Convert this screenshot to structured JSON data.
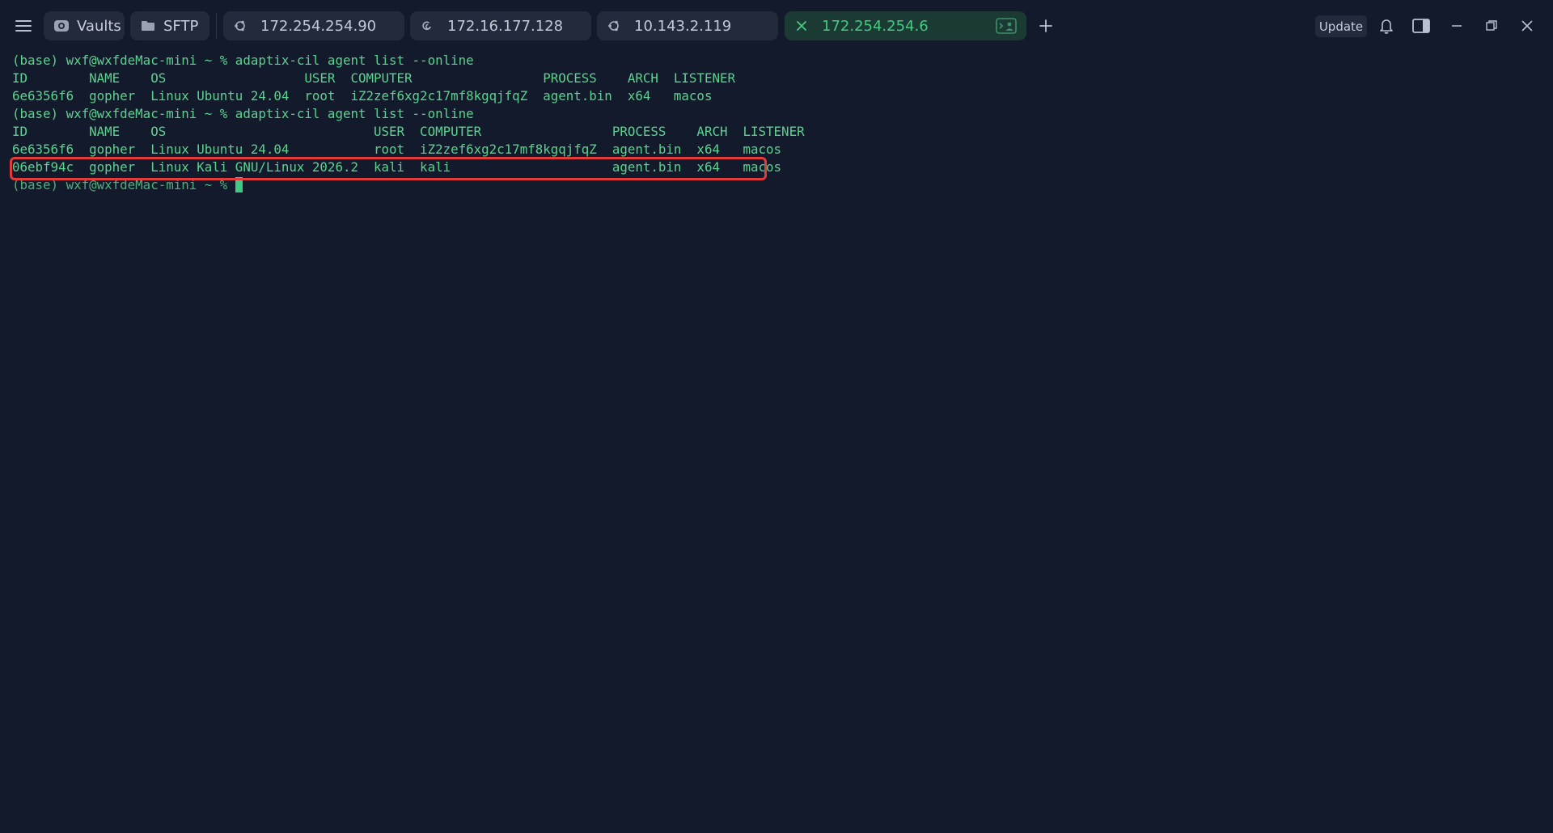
{
  "toolbar": {
    "vaults_label": "Vaults",
    "sftp_label": "SFTP",
    "update_label": "Update"
  },
  "tabs": [
    {
      "label": "172.254.254.90",
      "icon": "ubuntu-icon",
      "active": false
    },
    {
      "label": "172.16.177.128",
      "icon": "debian-swirl-icon",
      "active": false
    },
    {
      "label": "10.143.2.119",
      "icon": "ubuntu-icon",
      "active": false
    },
    {
      "label": "172.254.254.6",
      "icon": "close-icon",
      "active": true
    }
  ],
  "terminal": {
    "lines": [
      "(base) wxf@wxfdeMac-mini ~ % adaptix-cil agent list --online",
      "ID        NAME    OS                  USER  COMPUTER                 PROCESS    ARCH  LISTENER",
      "6e6356f6  gopher  Linux Ubuntu 24.04  root  iZ2zef6xg2c17mf8kgqjfqZ  agent.bin  x64   macos",
      "(base) wxf@wxfdeMac-mini ~ % adaptix-cil agent list --online",
      "ID        NAME    OS                           USER  COMPUTER                 PROCESS    ARCH  LISTENER",
      "6e6356f6  gopher  Linux Ubuntu 24.04           root  iZ2zef6xg2c17mf8kgqjfqZ  agent.bin  x64   macos",
      "06ebf94c  gopher  Linux Kali GNU/Linux 2026.2  kali  kali                     agent.bin  x64   macos"
    ],
    "prompt": "(base) wxf@wxfdeMac-mini ~ % "
  },
  "colors": {
    "background": "#131a2b",
    "terminal_text": "#5cd28e",
    "active_tab_bg": "#1b3a33",
    "active_tab_text": "#46c982",
    "highlight_border": "#e23b3b"
  }
}
